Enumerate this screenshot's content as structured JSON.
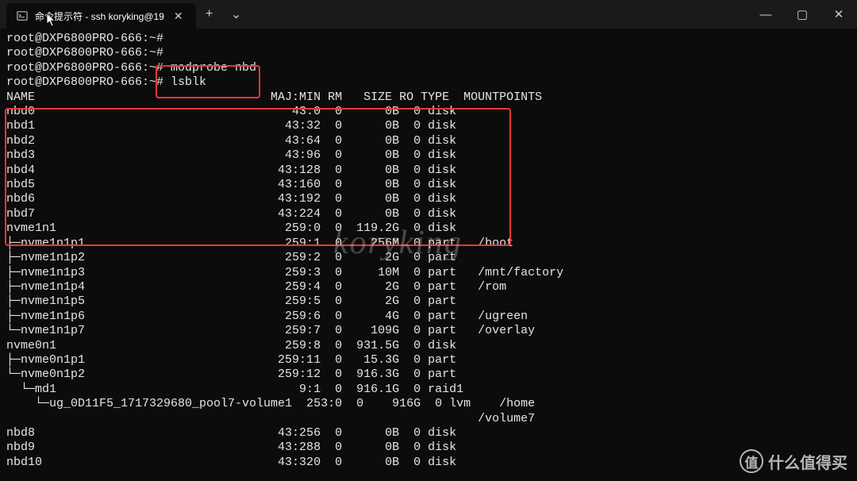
{
  "titlebar": {
    "tab_title": "命令提示符 - ssh  koryking@19",
    "new_tab_label": "+",
    "dropdown_label": "⌄",
    "minimize": "—",
    "maximize": "▢",
    "close": "✕"
  },
  "prompt": "root@DXP6800PRO-666:~#",
  "commands": {
    "blank1": "",
    "blank2": "",
    "modprobe": "modprobe nbd",
    "lsblk": "lsblk"
  },
  "header": "NAME                                 MAJ:MIN RM   SIZE RO TYPE  MOUNTPOINTS",
  "rows": [
    {
      "n": "nbd0",
      "mm": " 43:0",
      "rm": "0",
      "sz": "    0B",
      "ro": "0",
      "ty": "disk",
      "mp": "",
      "p": 0,
      "l": false
    },
    {
      "n": "nbd1",
      "mm": " 43:32",
      "rm": "0",
      "sz": "    0B",
      "ro": "0",
      "ty": "disk",
      "mp": "",
      "p": 0,
      "l": false
    },
    {
      "n": "nbd2",
      "mm": " 43:64",
      "rm": "0",
      "sz": "    0B",
      "ro": "0",
      "ty": "disk",
      "mp": "",
      "p": 0,
      "l": false
    },
    {
      "n": "nbd3",
      "mm": " 43:96",
      "rm": "0",
      "sz": "    0B",
      "ro": "0",
      "ty": "disk",
      "mp": "",
      "p": 0,
      "l": false
    },
    {
      "n": "nbd4",
      "mm": " 43:128",
      "rm": "0",
      "sz": "    0B",
      "ro": "0",
      "ty": "disk",
      "mp": "",
      "p": 0,
      "l": false
    },
    {
      "n": "nbd5",
      "mm": " 43:160",
      "rm": "0",
      "sz": "    0B",
      "ro": "0",
      "ty": "disk",
      "mp": "",
      "p": 0,
      "l": false
    },
    {
      "n": "nbd6",
      "mm": " 43:192",
      "rm": "0",
      "sz": "    0B",
      "ro": "0",
      "ty": "disk",
      "mp": "",
      "p": 0,
      "l": false
    },
    {
      "n": "nbd7",
      "mm": " 43:224",
      "rm": "0",
      "sz": "    0B",
      "ro": "0",
      "ty": "disk",
      "mp": "",
      "p": 0,
      "l": false
    },
    {
      "n": "nvme1n1",
      "mm": "259:0",
      "rm": "0",
      "sz": "119.2G",
      "ro": "0",
      "ty": "disk",
      "mp": "",
      "p": 0,
      "l": false
    },
    {
      "n": "nvme1n1p1",
      "mm": "259:1",
      "rm": "0",
      "sz": "  256M",
      "ro": "0",
      "ty": "part",
      "mp": "/boot",
      "p": 1,
      "l": false
    },
    {
      "n": "nvme1n1p2",
      "mm": "259:2",
      "rm": "0",
      "sz": "    2G",
      "ro": "0",
      "ty": "part",
      "mp": "",
      "p": 1,
      "l": false
    },
    {
      "n": "nvme1n1p3",
      "mm": "259:3",
      "rm": "0",
      "sz": "   10M",
      "ro": "0",
      "ty": "part",
      "mp": "/mnt/factory",
      "p": 1,
      "l": false
    },
    {
      "n": "nvme1n1p4",
      "mm": "259:4",
      "rm": "0",
      "sz": "    2G",
      "ro": "0",
      "ty": "part",
      "mp": "/rom",
      "p": 1,
      "l": false
    },
    {
      "n": "nvme1n1p5",
      "mm": "259:5",
      "rm": "0",
      "sz": "    2G",
      "ro": "0",
      "ty": "part",
      "mp": "",
      "p": 1,
      "l": false
    },
    {
      "n": "nvme1n1p6",
      "mm": "259:6",
      "rm": "0",
      "sz": "    4G",
      "ro": "0",
      "ty": "part",
      "mp": "/ugreen",
      "p": 1,
      "l": false
    },
    {
      "n": "nvme1n1p7",
      "mm": "259:7",
      "rm": "0",
      "sz": "  109G",
      "ro": "0",
      "ty": "part",
      "mp": "/overlay",
      "p": 1,
      "l": true
    },
    {
      "n": "nvme0n1",
      "mm": "259:8",
      "rm": "0",
      "sz": "931.5G",
      "ro": "0",
      "ty": "disk",
      "mp": "",
      "p": 0,
      "l": false
    },
    {
      "n": "nvme0n1p1",
      "mm": "259:11",
      "rm": "0",
      "sz": " 15.3G",
      "ro": "0",
      "ty": "part",
      "mp": "",
      "p": 1,
      "l": false
    },
    {
      "n": "nvme0n1p2",
      "mm": "259:12",
      "rm": "0",
      "sz": "916.3G",
      "ro": "0",
      "ty": "part",
      "mp": "",
      "p": 1,
      "l": true
    },
    {
      "n": "md1",
      "mm": "  9:1",
      "rm": "0",
      "sz": "916.1G",
      "ro": "0",
      "ty": "raid1",
      "mp": "",
      "p": 2,
      "l": true
    },
    {
      "n": "ug_0D11F5_1717329680_pool7-volume1",
      "mm": "253:0",
      "rm": "0",
      "sz": "  916G",
      "ro": "0",
      "ty": "lvm",
      "mp": "/home",
      "p": 3,
      "l": true
    },
    {
      "n": "",
      "mm": "",
      "rm": "",
      "sz": "",
      "ro": "",
      "ty": "",
      "mp": "/volume7",
      "p": 0,
      "l": false,
      "mpline": true
    },
    {
      "n": "nbd8",
      "mm": " 43:256",
      "rm": "0",
      "sz": "    0B",
      "ro": "0",
      "ty": "disk",
      "mp": "",
      "p": 0,
      "l": false
    },
    {
      "n": "nbd9",
      "mm": " 43:288",
      "rm": "0",
      "sz": "    0B",
      "ro": "0",
      "ty": "disk",
      "mp": "",
      "p": 0,
      "l": false
    },
    {
      "n": "nbd10",
      "mm": " 43:320",
      "rm": "0",
      "sz": "    0B",
      "ro": "0",
      "ty": "disk",
      "mp": "",
      "p": 0,
      "l": false
    }
  ],
  "watermark": "koryking",
  "brand": {
    "icon": "值",
    "text": "什么值得买"
  }
}
